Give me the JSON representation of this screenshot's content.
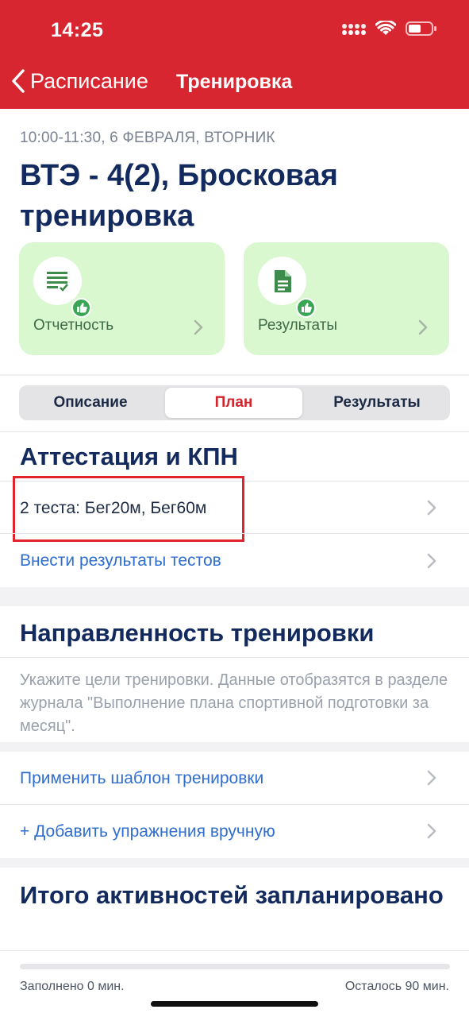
{
  "status_bar": {
    "time": "14:25"
  },
  "nav": {
    "back_label": "Расписание",
    "title": "Тренировка"
  },
  "header": {
    "date_line": "10:00-11:30, 6 ФЕВРАЛЯ, ВТОРНИК",
    "title": "ВТЭ - 4(2), Бросковая тренировка"
  },
  "cards": [
    {
      "label": "Отчетность",
      "icon": "report-list-icon"
    },
    {
      "label": "Результаты",
      "icon": "document-icon"
    }
  ],
  "tabs": {
    "items": [
      "Описание",
      "План",
      "Результаты"
    ],
    "active": "План"
  },
  "attestation": {
    "heading": "Аттестация и КПН",
    "tests_label": "2 теста: Бег20м, Бег60м",
    "enter_results_link": "Внести результаты тестов"
  },
  "focus": {
    "heading": "Направленность тренировки",
    "hint": "Укажите цели тренировки. Данные отобразятся в разделе журнала \"Выполнение плана спортивной подготовки за месяц\"."
  },
  "actions": {
    "apply_template": "Применить шаблон тренировки",
    "add_exercises": "+ Добавить упражнения вручную"
  },
  "summary": {
    "heading": "Итого активностей запланировано",
    "filled": "Заполнено 0 мин.",
    "remaining": "Осталось 90 мин.",
    "progress_fraction": 0
  },
  "colors": {
    "brand_red": "#d7262f",
    "card_green": "#d9f8cf",
    "link_blue": "#2f6ed0",
    "heading_navy": "#132a5e"
  }
}
